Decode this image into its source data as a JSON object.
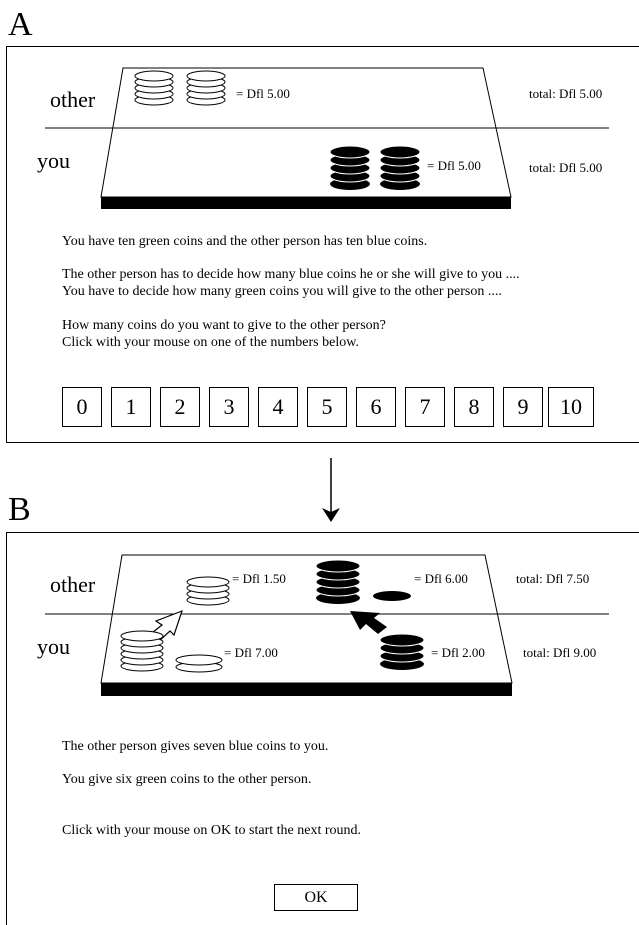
{
  "panel_a": {
    "label": "A",
    "rows": {
      "other": "other",
      "you": "you"
    },
    "other_amount": "= Dfl 5.00",
    "you_amount": "= Dfl 5.00",
    "other_total": "total: Dfl 5.00",
    "you_total": "total: Dfl 5.00",
    "text_1": "You have ten green coins and the other person has ten blue coins.",
    "text_2": "The other person has to decide how many blue coins he or she will give to you ....",
    "text_3": "You have to decide how many green coins you will give to the other person ....",
    "text_4": "How many coins do you want to give to the other person?",
    "text_5": "Click with your mouse on one of the numbers below.",
    "numbers": [
      "0",
      "1",
      "2",
      "3",
      "4",
      "5",
      "6",
      "7",
      "8",
      "9",
      "10"
    ]
  },
  "panel_b": {
    "label": "B",
    "rows": {
      "other": "other",
      "you": "you"
    },
    "other_green_amount": "= Dfl 1.50",
    "other_black_amount": "= Dfl 6.00",
    "you_green_amount": "= Dfl 7.00",
    "you_black_amount": "= Dfl 2.00",
    "other_total": "total: Dfl 7.50",
    "you_total": "total: Dfl 9.00",
    "text_1": "The other person gives seven blue coins to you.",
    "text_2": "You give six green coins to the other person.",
    "text_3": "Click with your mouse on OK to start the next round.",
    "ok_label": "OK"
  }
}
